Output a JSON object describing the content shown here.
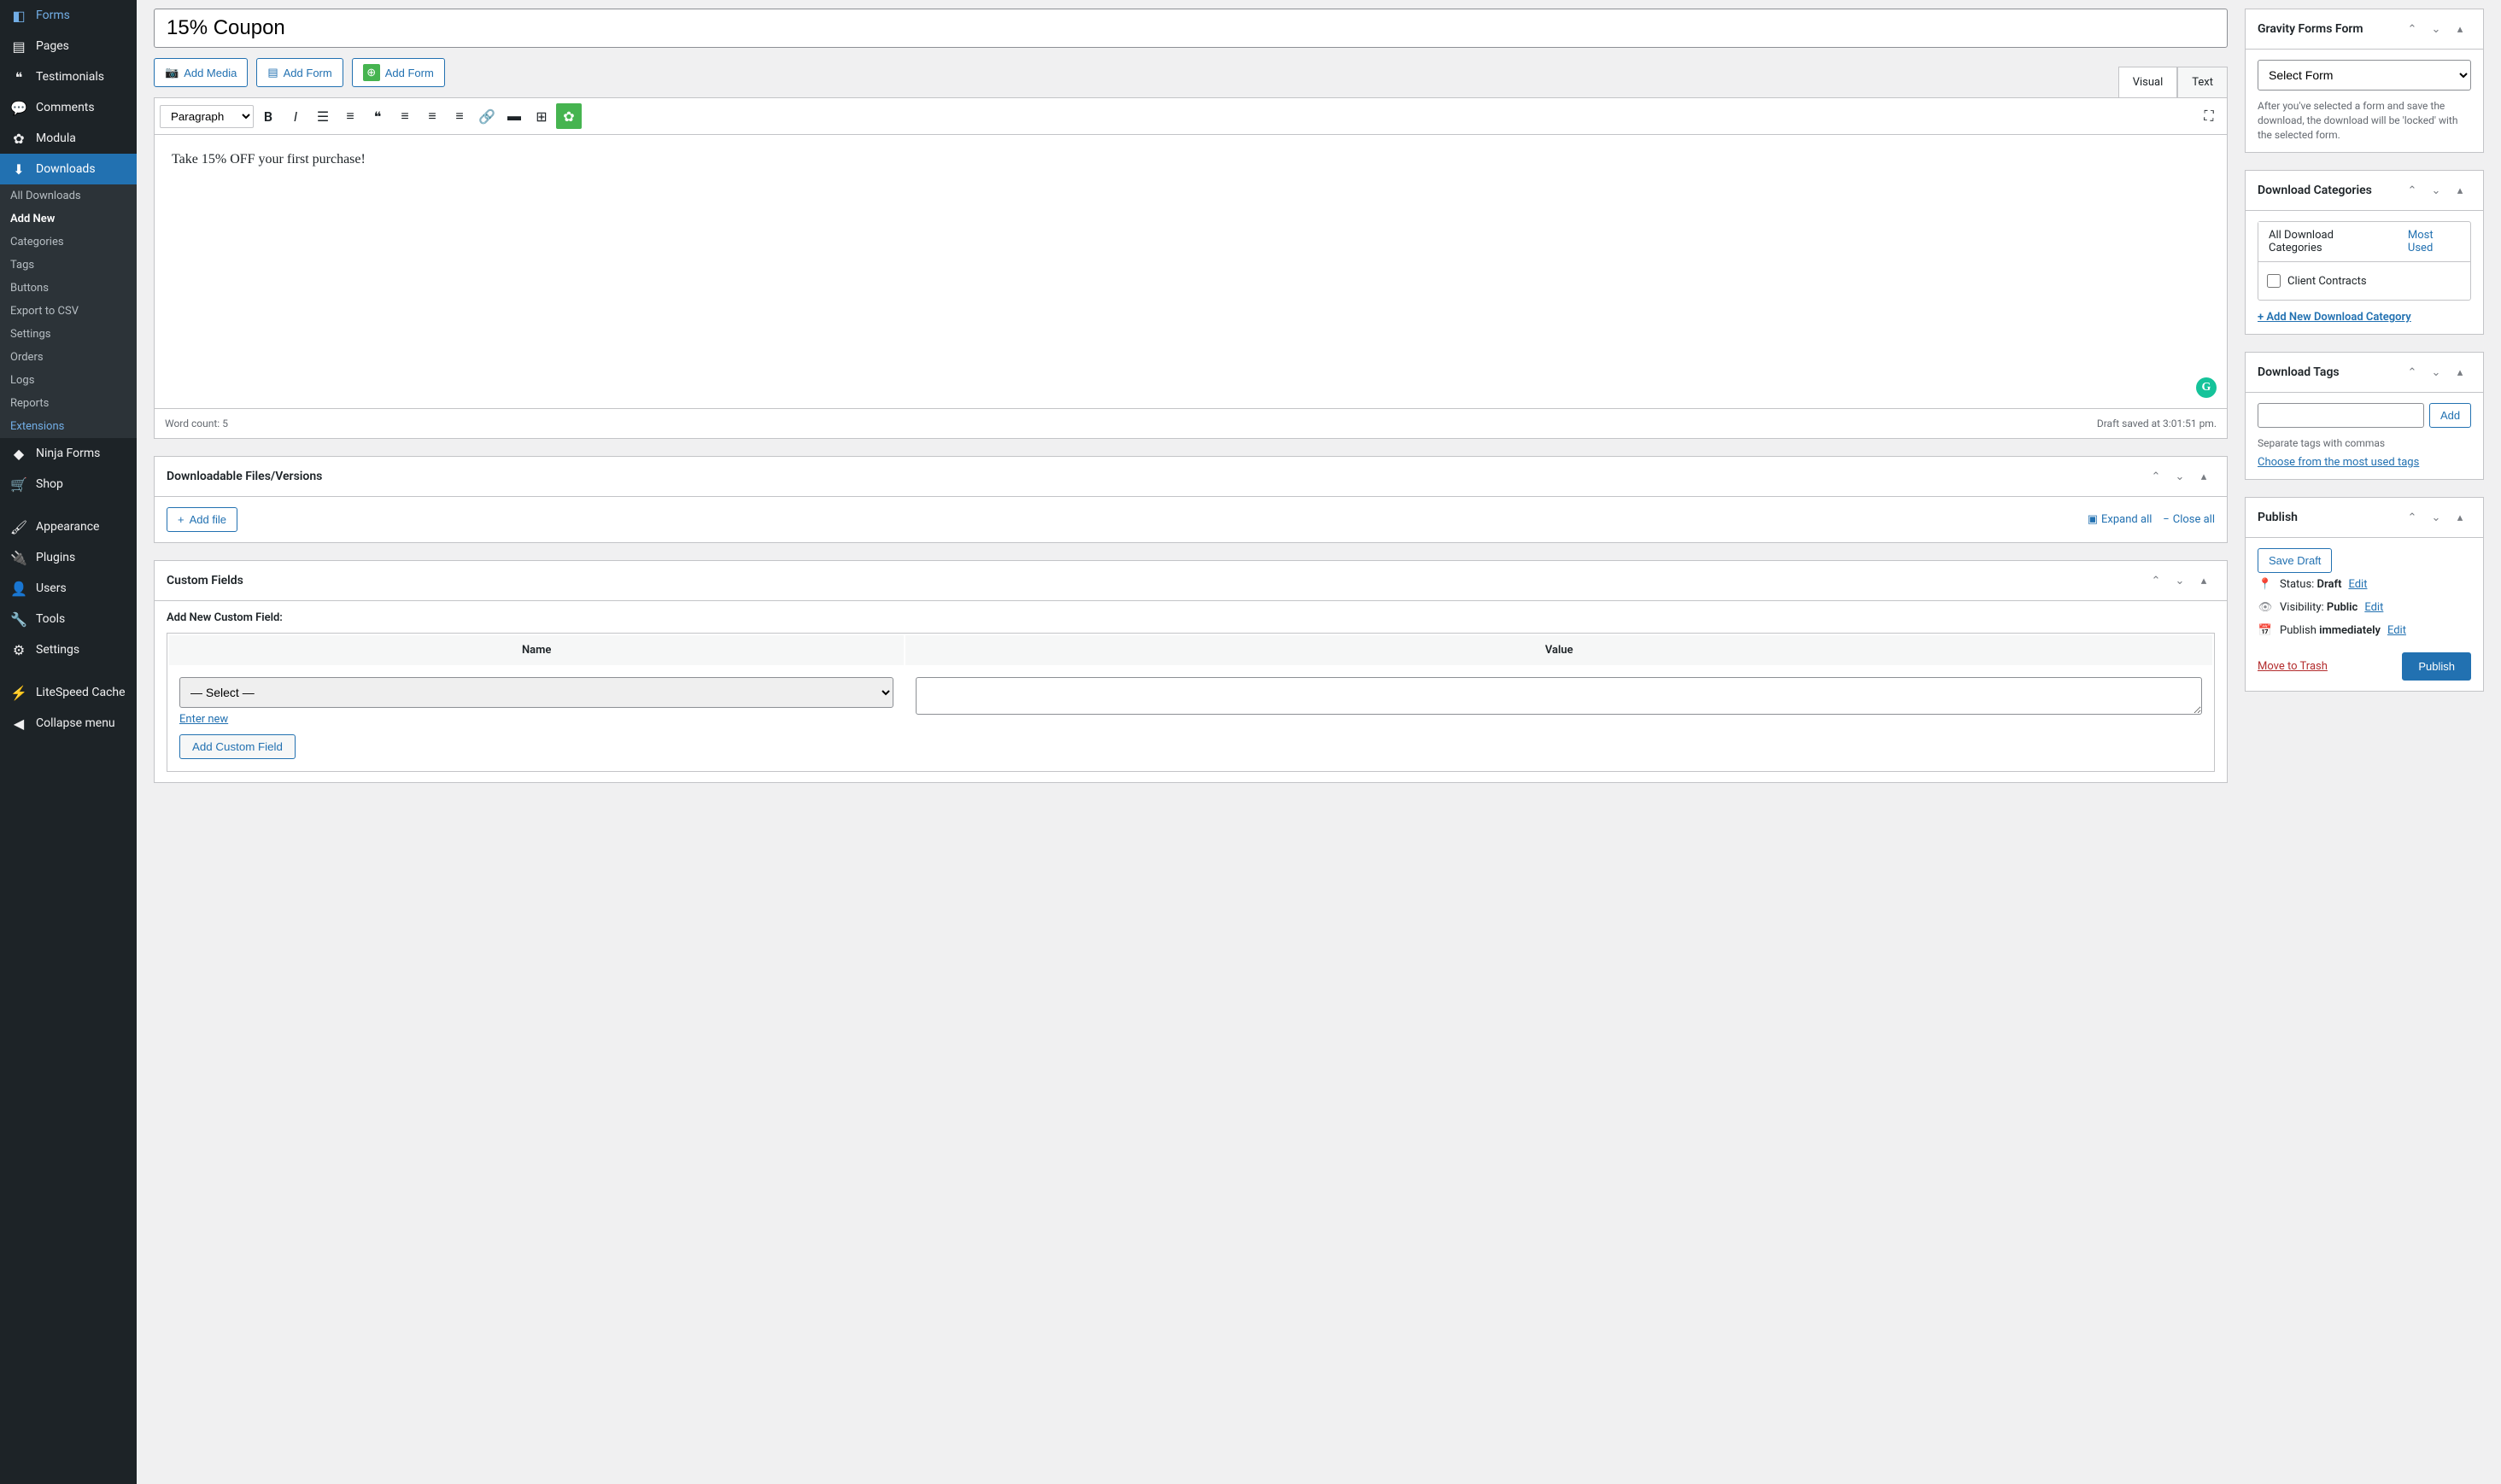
{
  "sidebar": {
    "items": [
      {
        "label": "Forms",
        "icon": "◧"
      },
      {
        "label": "Pages",
        "icon": "▤"
      },
      {
        "label": "Testimonials",
        "icon": "❝"
      },
      {
        "label": "Comments",
        "icon": "💬"
      },
      {
        "label": "Modula",
        "icon": "✿"
      },
      {
        "label": "Downloads",
        "icon": "⬇"
      }
    ],
    "submenu": [
      {
        "label": "All Downloads"
      },
      {
        "label": "Add New",
        "current": true
      },
      {
        "label": "Categories"
      },
      {
        "label": "Tags"
      },
      {
        "label": "Buttons"
      },
      {
        "label": "Export to CSV"
      },
      {
        "label": "Settings"
      },
      {
        "label": "Orders"
      },
      {
        "label": "Logs"
      },
      {
        "label": "Reports"
      },
      {
        "label": "Extensions",
        "link": true
      }
    ],
    "bottom": [
      {
        "label": "Ninja Forms",
        "icon": "◆"
      },
      {
        "label": "Shop",
        "icon": "🛒"
      },
      {
        "label": "Appearance",
        "icon": "🖌"
      },
      {
        "label": "Plugins",
        "icon": "🔌"
      },
      {
        "label": "Users",
        "icon": "👤"
      },
      {
        "label": "Tools",
        "icon": "🔧"
      },
      {
        "label": "Settings",
        "icon": "⚙"
      },
      {
        "label": "LiteSpeed Cache",
        "icon": "⚡"
      },
      {
        "label": "Collapse menu",
        "icon": "◀"
      }
    ]
  },
  "title": "15% Coupon",
  "actions": {
    "add_media": "Add Media",
    "add_form1": "Add Form",
    "add_form2": "Add Form"
  },
  "editor": {
    "tabs": {
      "visual": "Visual",
      "text": "Text"
    },
    "format": "Paragraph",
    "content": "Take 15% OFF your first purchase!",
    "word_count_label": "Word count: ",
    "word_count": "5",
    "draft_saved": "Draft saved at 3:01:51 pm."
  },
  "downloadable": {
    "title": "Downloadable Files/Versions",
    "add_file": "Add file",
    "expand": "Expand all",
    "close": "Close all"
  },
  "custom_fields": {
    "title": "Custom Fields",
    "add_new": "Add New Custom Field:",
    "col_name": "Name",
    "col_value": "Value",
    "select_placeholder": "— Select —",
    "enter_new": "Enter new",
    "add_btn": "Add Custom Field"
  },
  "gravity": {
    "title": "Gravity Forms Form",
    "select": "Select Form",
    "hint": "After you've selected a form and save the download, the download will be 'locked' with the selected form."
  },
  "categories": {
    "title": "Download Categories",
    "tab_all": "All Download Categories",
    "tab_most": "Most Used",
    "items": [
      {
        "label": "Client Contracts"
      }
    ],
    "add_new": "+ Add New Download Category"
  },
  "tags": {
    "title": "Download Tags",
    "add_btn": "Add",
    "hint": "Separate tags with commas",
    "choose": "Choose from the most used tags"
  },
  "publish": {
    "title": "Publish",
    "save_draft": "Save Draft",
    "status_label": "Status: ",
    "status_value": "Draft",
    "visibility_label": "Visibility: ",
    "visibility_value": "Public",
    "publish_label": "Publish ",
    "publish_value": "immediately",
    "edit": "Edit",
    "trash": "Move to Trash",
    "publish_btn": "Publish"
  }
}
